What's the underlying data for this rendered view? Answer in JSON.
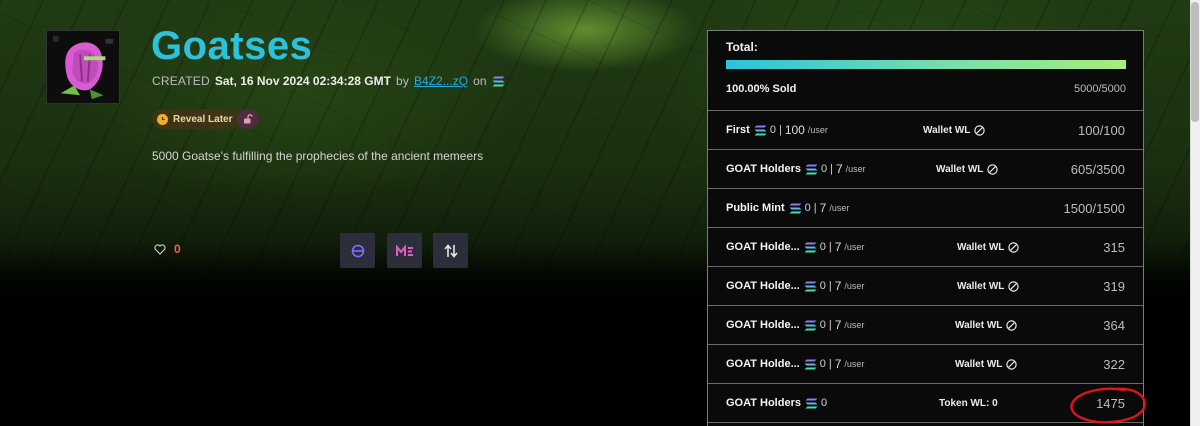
{
  "collection": {
    "title": "Goatses",
    "created_label": "CREATED",
    "created_date": "Sat, 16 Nov 2024 02:34:28 GMT",
    "by_label": "by",
    "creator": "B4Z2...zQ",
    "on_label": "on",
    "reveal_badge": "Reveal Later",
    "description": "5000 Goatse's fulfilling the prophecies of the ancient memeers",
    "likes": "0"
  },
  "links": {
    "icons": [
      "magiceden-swap-icon",
      "magiceden-icon",
      "tensor-icon"
    ]
  },
  "mint": {
    "total_label": "Total:",
    "progress_fraction": 1.0,
    "sold_percent": "100.00% Sold",
    "sold_count": "5000/5000"
  },
  "phases": [
    {
      "name": "First",
      "price": "0",
      "sep": "|",
      "limit": "100",
      "per": "/user",
      "wl": "Wallet WL",
      "count": "100/100"
    },
    {
      "name": "GOAT Holders",
      "price": "0",
      "sep": "|",
      "limit": "7",
      "per": "/user",
      "wl": "Wallet WL",
      "count": "605/3500"
    },
    {
      "name": "Public Mint",
      "price": "0",
      "sep": "|",
      "limit": "7",
      "per": "/user",
      "wl": "",
      "count": "1500/1500"
    },
    {
      "name": "GOAT Holde...",
      "price": "0",
      "sep": "|",
      "limit": "7",
      "per": "/user",
      "wl": "Wallet WL",
      "count": "315"
    },
    {
      "name": "GOAT Holde...",
      "price": "0",
      "sep": "|",
      "limit": "7",
      "per": "/user",
      "wl": "Wallet WL",
      "count": "319"
    },
    {
      "name": "GOAT Holde...",
      "price": "0",
      "sep": "|",
      "limit": "7",
      "per": "/user",
      "wl": "Wallet WL",
      "count": "364"
    },
    {
      "name": "GOAT Holde...",
      "price": "0",
      "sep": "|",
      "limit": "7",
      "per": "/user",
      "wl": "Wallet WL",
      "count": "322"
    },
    {
      "name": "GOAT Holders",
      "price": "0",
      "sep": "",
      "limit": "",
      "per": "",
      "wl": "Token WL: 0",
      "count": "1475"
    }
  ],
  "colors": {
    "title": "#2cc2dc",
    "creator_link": "#2aa8e0",
    "likes": "#ff5a5a",
    "annotation": "#e0141e"
  }
}
